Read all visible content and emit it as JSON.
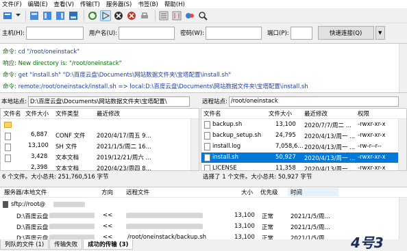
{
  "menu": [
    "文件(F)",
    "编辑(E)",
    "查看(V)",
    "传输(T)",
    "服务器(S)",
    "书签(B)",
    "帮助(H)"
  ],
  "quickconnect": {
    "host_label": "主机(H):",
    "user_label": "用户名(U):",
    "pass_label": "密码(W):",
    "port_label": "端口(P):",
    "button": "快速连接(Q)"
  },
  "log": [
    {
      "label": "命令:",
      "text": "cd \"/root/oneinstack\"",
      "type": "cmd"
    },
    {
      "label": "响应:",
      "text": "New directory is: \"/root/oneinstack\"",
      "type": "resp"
    },
    {
      "label": "命令:",
      "text": "get \"install.sh\" \"D:\\百度云盘\\Documents\\网站数据文件夹\\宝塔配置\\install.sh\"",
      "type": "cmd"
    },
    {
      "label": "命令:",
      "text": "remote:/root/oneinstack/install.sh => local:D:\\百度云盘\\Documents\\网站数据文件夹\\宝塔配置\\install.sh",
      "type": "cmd"
    }
  ],
  "local": {
    "site_label": "本地站点:",
    "path": "D:\\百度云盘\\Documents\\网站数据文件夹\\宝塔配置\\",
    "headers": [
      "文件名",
      "文件大小",
      "文件类型",
      "最近修改"
    ],
    "rows": [
      {
        "name": "..",
        "size": "",
        "type": "",
        "date": "",
        "kind": "folder"
      },
      {
        "name": "",
        "size": "6,887",
        "type": "CONF 文件",
        "date": "2020/4/17/周五 9...",
        "kind": "file"
      },
      {
        "name": "",
        "size": "13,100",
        "type": "SH 文件",
        "date": "2021/1/5/周二 16...",
        "kind": "file"
      },
      {
        "name": "",
        "size": "3,428",
        "type": "文本文档",
        "date": "2019/12/21/周六 ...",
        "kind": "file"
      },
      {
        "name": "",
        "size": "2,398",
        "type": "文本文档",
        "date": "2020/4/23/周四 8...",
        "kind": "file"
      }
    ],
    "status": "6 个文件。大小总共: 251,760,516 字节"
  },
  "remote": {
    "site_label": "远程站点:",
    "path": "/root/oneinstack",
    "headers": [
      "文件名",
      "文件大小",
      "最近修改",
      "权限"
    ],
    "rows": [
      {
        "name": "backup.sh",
        "size": "13,100",
        "date": "2020/7/7/周二 ...",
        "perm": "-rwxr-xr-x",
        "selected": false
      },
      {
        "name": "backup_setup.sh",
        "size": "24,795",
        "date": "2020/4/13/周一 ...",
        "perm": "-rwxr-xr-x",
        "selected": false
      },
      {
        "name": "install.log",
        "size": "7,058,6...",
        "date": "2020/4/13/周一 ...",
        "perm": "-rw-r--r--",
        "selected": false
      },
      {
        "name": "install.sh",
        "size": "50,927",
        "date": "2020/4/13/周一 ...",
        "perm": "-rwxr-xr-x",
        "selected": true
      },
      {
        "name": "LICENSE",
        "size": "11,358",
        "date": "2020/4/13/周一 ...",
        "perm": "-rwxr-xr-x",
        "selected": false
      }
    ],
    "status": "选择了 1 个文件。大小总共: 50,927 字节"
  },
  "queue": {
    "headers": [
      "服务器/本地文件",
      "方向",
      "远程文件",
      "大小",
      "优先级",
      "时间"
    ],
    "server": "sftp://root@",
    "rows": [
      {
        "local": "D:\\百度云盘",
        "dir": "<<",
        "remote": "",
        "size": "13,100",
        "prio": "正常",
        "time": "2021/1/5/周..."
      },
      {
        "local": "D:\\百度云盘",
        "dir": "<<",
        "remote": "",
        "size": "13,100",
        "prio": "正常",
        "time": "2021/1/5/周..."
      },
      {
        "local": "D:\\百度云盘",
        "dir": "<<",
        "remote": "/root/oneinstack/backup.sh",
        "size": "13,100",
        "prio": "正常",
        "time": "2021/1/5/周..."
      }
    ]
  },
  "tabs": [
    "列队的文件 (1)",
    "传输失败",
    "成功的传输 (3)"
  ],
  "watermark": "4号3"
}
